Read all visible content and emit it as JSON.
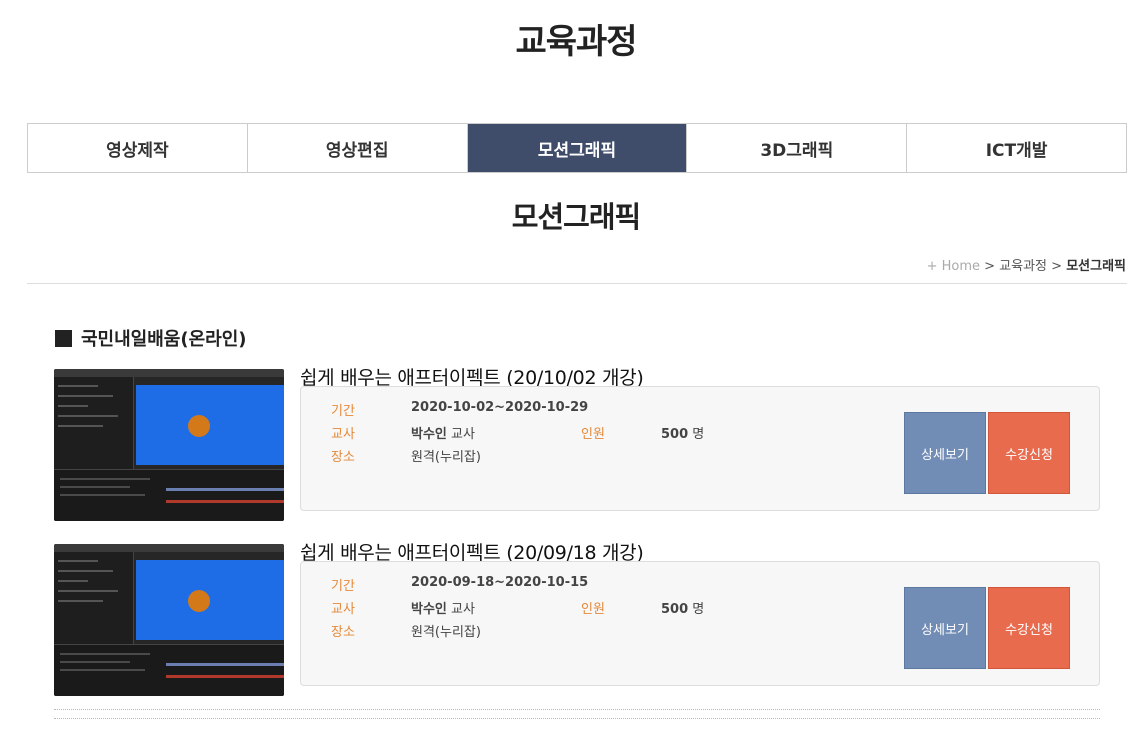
{
  "page": {
    "title": "교육과정"
  },
  "tabs": [
    {
      "label": "영상제작",
      "active": false
    },
    {
      "label": "영상편집",
      "active": false
    },
    {
      "label": "모션그래픽",
      "active": true
    },
    {
      "label": "3D그래픽",
      "active": false
    },
    {
      "label": "ICT개발",
      "active": false
    }
  ],
  "section": {
    "title": "모션그래픽"
  },
  "breadcrumb": {
    "home": "+ Home",
    "sep1": " > ",
    "level1": "교육과정",
    "sep2": " > ",
    "current": "모션그래픽"
  },
  "category": {
    "title": "국민내일배움(온라인)"
  },
  "labels": {
    "period": "기간",
    "teacher": "교사",
    "place": "장소",
    "capacity": "인원",
    "teacher_suffix": " 교사",
    "capacity_suffix": " 명",
    "detail_button": "상세보기",
    "apply_button": "수강신청"
  },
  "courses": [
    {
      "title": "쉽게 배우는 애프터이펙트 (20/10/02 개강)",
      "period": "2020-10-02~2020-10-29",
      "teacher": "박수인",
      "capacity": "500",
      "place": "원격(누리잡)"
    },
    {
      "title": "쉽게 배우는 애프터이펙트 (20/09/18 개강)",
      "period": "2020-09-18~2020-10-15",
      "teacher": "박수인",
      "capacity": "500",
      "place": "원격(누리잡)"
    }
  ],
  "colors": {
    "active_tab": "#3f4d6b",
    "label": "#e68a3a",
    "detail_button": "#718cb5",
    "apply_button": "#e86b4e",
    "thumb_canvas": "#1f6de6",
    "thumb_dot": "#d4791a"
  },
  "icons": {
    "category_marker": "square-bullet-icon",
    "thumbnail": "after-effects-screenshot"
  }
}
